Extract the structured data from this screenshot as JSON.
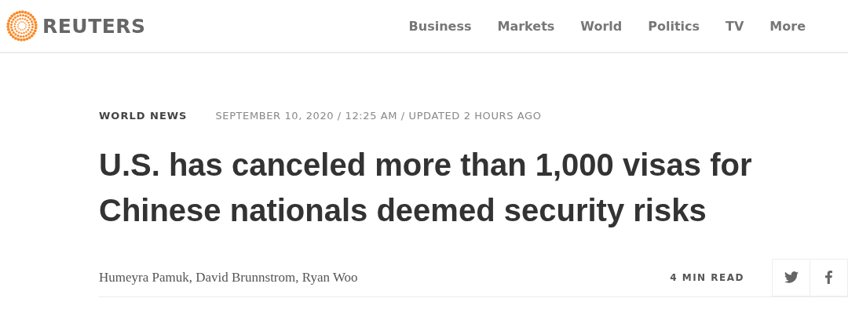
{
  "header": {
    "logo_text": "REUTERS",
    "nav": [
      {
        "label": "Business"
      },
      {
        "label": "Markets"
      },
      {
        "label": "World"
      },
      {
        "label": "Politics"
      },
      {
        "label": "TV"
      },
      {
        "label": "More"
      }
    ]
  },
  "article": {
    "category": "WORLD NEWS",
    "dateline": "SEPTEMBER 10, 2020 / 12:25 AM / UPDATED 2 HOURS AGO",
    "headline": "U.S. has canceled more than 1,000 visas for Chinese nationals deemed security risks",
    "byline": "Humeyra Pamuk, David Brunnstrom, Ryan Woo",
    "read_time": "4 MIN READ",
    "share": [
      {
        "kind": "twitter"
      },
      {
        "kind": "facebook"
      }
    ]
  }
}
